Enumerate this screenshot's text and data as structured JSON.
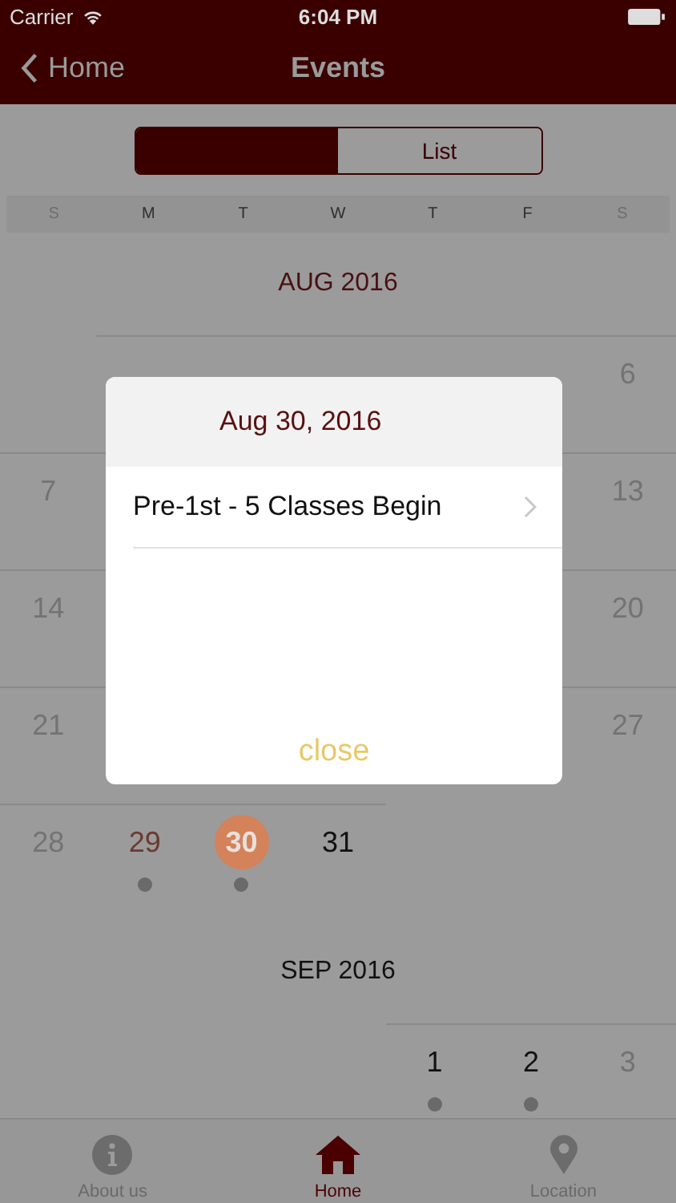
{
  "status_bar": {
    "carrier": "Carrier",
    "time": "6:04 PM"
  },
  "nav": {
    "back": "Home",
    "title": "Events"
  },
  "segments": [
    {
      "selected": true
    },
    {
      "label": "List",
      "selected": false
    }
  ],
  "weekdays": [
    "S",
    "M",
    "T",
    "W",
    "T",
    "F",
    "S"
  ],
  "months": [
    {
      "title": "AUG 2016",
      "current": true,
      "weeks": [
        [
          {
            "kind": "empty"
          },
          {
            "kind": "covered"
          },
          {
            "kind": "covered"
          },
          {
            "kind": "covered"
          },
          {
            "kind": "covered"
          },
          {
            "kind": "covered"
          },
          {
            "kind": "day",
            "day": "6",
            "event": false,
            "today": false,
            "selected": false
          }
        ],
        [
          {
            "kind": "day",
            "day": "7",
            "event": false,
            "today": false,
            "selected": false
          },
          {
            "kind": "covered"
          },
          {
            "kind": "covered"
          },
          {
            "kind": "covered"
          },
          {
            "kind": "covered"
          },
          {
            "kind": "covered"
          },
          {
            "kind": "day",
            "day": "13",
            "event": false,
            "today": false,
            "selected": false
          }
        ],
        [
          {
            "kind": "day",
            "day": "14",
            "event": false,
            "today": false,
            "selected": false
          },
          {
            "kind": "covered"
          },
          {
            "kind": "covered"
          },
          {
            "kind": "covered"
          },
          {
            "kind": "covered"
          },
          {
            "kind": "covered"
          },
          {
            "kind": "day",
            "day": "20",
            "event": false,
            "today": false,
            "selected": false
          }
        ],
        [
          {
            "kind": "day",
            "day": "21",
            "event": false,
            "today": false,
            "selected": false
          },
          {
            "kind": "covered"
          },
          {
            "kind": "covered"
          },
          {
            "kind": "covered"
          },
          {
            "kind": "covered"
          },
          {
            "kind": "covered"
          },
          {
            "kind": "day",
            "day": "27",
            "event": false,
            "today": false,
            "selected": false
          }
        ],
        [
          {
            "kind": "day",
            "day": "28",
            "event": false,
            "today": false,
            "selected": false
          },
          {
            "kind": "day",
            "day": "29",
            "event": true,
            "today": true,
            "selected": false
          },
          {
            "kind": "day",
            "day": "30",
            "event": true,
            "today": false,
            "selected": true
          },
          {
            "kind": "day",
            "day": "31",
            "event": false,
            "today": false,
            "selected": false
          },
          {
            "kind": "empty"
          },
          {
            "kind": "empty"
          },
          {
            "kind": "empty"
          }
        ]
      ]
    },
    {
      "title": "SEP 2016",
      "current": false,
      "weeks": [
        [
          {
            "kind": "empty"
          },
          {
            "kind": "empty"
          },
          {
            "kind": "empty"
          },
          {
            "kind": "empty"
          },
          {
            "kind": "day",
            "day": "1",
            "event": true,
            "today": false,
            "selected": false
          },
          {
            "kind": "day",
            "day": "2",
            "event": true,
            "today": false,
            "selected": false
          },
          {
            "kind": "day",
            "day": "3",
            "event": false,
            "today": false,
            "selected": false
          }
        ]
      ]
    }
  ],
  "popup": {
    "date": "Aug 30, 2016",
    "events": [
      "Pre-1st - 5 Classes Begin"
    ],
    "close": "close"
  },
  "tabs": [
    {
      "label": "About us",
      "selected": false
    },
    {
      "label": "Home",
      "selected": true
    },
    {
      "label": "Location",
      "selected": false
    }
  ]
}
